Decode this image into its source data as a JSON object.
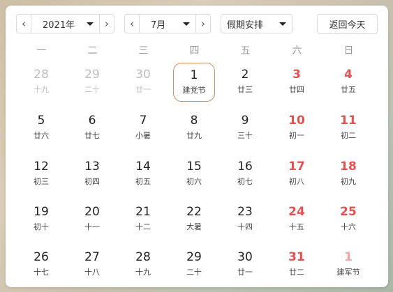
{
  "toolbar": {
    "year_value": "2021年",
    "month_value": "7月",
    "holiday_value": "假期安排",
    "today_label": "返回今天"
  },
  "weekdays": [
    "一",
    "二",
    "三",
    "四",
    "五",
    "六",
    "日"
  ],
  "weeks": [
    [
      {
        "day": "28",
        "sub": "十九",
        "other": true,
        "weekend": false
      },
      {
        "day": "29",
        "sub": "二十",
        "other": true,
        "weekend": false
      },
      {
        "day": "30",
        "sub": "廿一",
        "other": true,
        "weekend": false
      },
      {
        "day": "1",
        "sub": "建党节",
        "other": false,
        "weekend": false,
        "today": true
      },
      {
        "day": "2",
        "sub": "廿三",
        "other": false,
        "weekend": false
      },
      {
        "day": "3",
        "sub": "廿四",
        "other": false,
        "weekend": true
      },
      {
        "day": "4",
        "sub": "廿五",
        "other": false,
        "weekend": true
      }
    ],
    [
      {
        "day": "5",
        "sub": "廿六",
        "other": false,
        "weekend": false
      },
      {
        "day": "6",
        "sub": "廿七",
        "other": false,
        "weekend": false
      },
      {
        "day": "7",
        "sub": "小暑",
        "other": false,
        "weekend": false
      },
      {
        "day": "8",
        "sub": "廿九",
        "other": false,
        "weekend": false
      },
      {
        "day": "9",
        "sub": "三十",
        "other": false,
        "weekend": false
      },
      {
        "day": "10",
        "sub": "初一",
        "other": false,
        "weekend": true
      },
      {
        "day": "11",
        "sub": "初二",
        "other": false,
        "weekend": true
      }
    ],
    [
      {
        "day": "12",
        "sub": "初三",
        "other": false,
        "weekend": false
      },
      {
        "day": "13",
        "sub": "初四",
        "other": false,
        "weekend": false
      },
      {
        "day": "14",
        "sub": "初五",
        "other": false,
        "weekend": false
      },
      {
        "day": "15",
        "sub": "初六",
        "other": false,
        "weekend": false
      },
      {
        "day": "16",
        "sub": "初七",
        "other": false,
        "weekend": false
      },
      {
        "day": "17",
        "sub": "初八",
        "other": false,
        "weekend": true
      },
      {
        "day": "18",
        "sub": "初九",
        "other": false,
        "weekend": true
      }
    ],
    [
      {
        "day": "19",
        "sub": "初十",
        "other": false,
        "weekend": false
      },
      {
        "day": "20",
        "sub": "十一",
        "other": false,
        "weekend": false
      },
      {
        "day": "21",
        "sub": "十二",
        "other": false,
        "weekend": false
      },
      {
        "day": "22",
        "sub": "大暑",
        "other": false,
        "weekend": false
      },
      {
        "day": "23",
        "sub": "十四",
        "other": false,
        "weekend": false
      },
      {
        "day": "24",
        "sub": "十五",
        "other": false,
        "weekend": true
      },
      {
        "day": "25",
        "sub": "十六",
        "other": false,
        "weekend": true
      }
    ],
    [
      {
        "day": "26",
        "sub": "十七",
        "other": false,
        "weekend": false
      },
      {
        "day": "27",
        "sub": "十八",
        "other": false,
        "weekend": false
      },
      {
        "day": "28",
        "sub": "十九",
        "other": false,
        "weekend": false
      },
      {
        "day": "29",
        "sub": "二十",
        "other": false,
        "weekend": false
      },
      {
        "day": "30",
        "sub": "廿一",
        "other": false,
        "weekend": false
      },
      {
        "day": "31",
        "sub": "廿二",
        "other": false,
        "weekend": true
      },
      {
        "day": "1",
        "sub": "建军节",
        "other": true,
        "weekend": true
      }
    ]
  ],
  "colors": {
    "weekend": "#e05252",
    "today_border": "#c8926a",
    "muted": "#bdbdbd"
  },
  "icons": {
    "prev": "chevron-left-icon",
    "next": "chevron-right-icon",
    "dropdown": "caret-down-icon"
  }
}
